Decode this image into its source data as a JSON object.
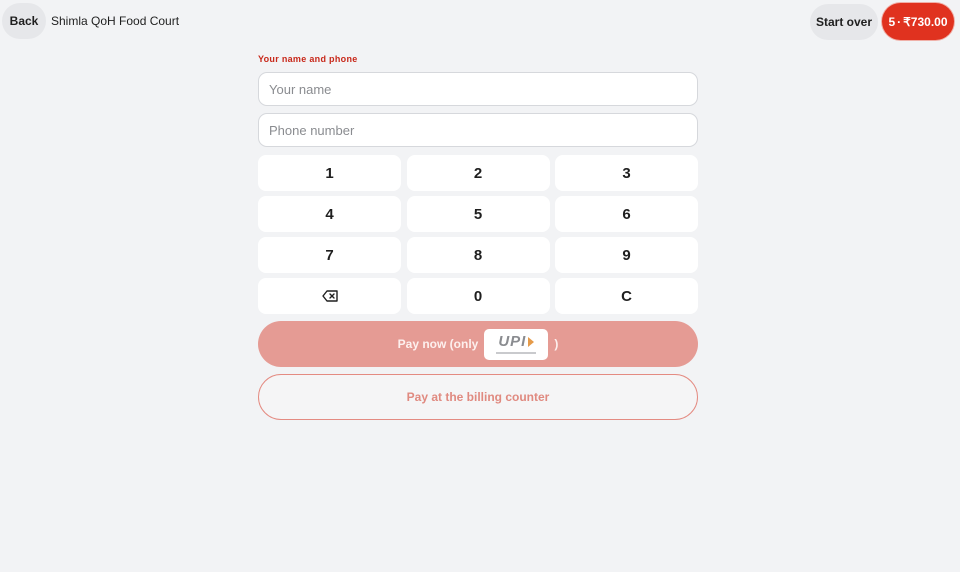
{
  "header": {
    "back_label": "Back",
    "venue_name": "Shimla QoH Food Court",
    "start_over_label": "Start over",
    "cart": {
      "count": "5",
      "separator": "·",
      "total": "₹730.00"
    }
  },
  "form": {
    "section_label": "Your name and phone",
    "name_placeholder": "Your name",
    "name_value": "",
    "phone_placeholder": "Phone number",
    "phone_value": ""
  },
  "keypad": {
    "keys": [
      "1",
      "2",
      "3",
      "4",
      "5",
      "6",
      "7",
      "8",
      "9",
      "backspace-icon",
      "0",
      "C"
    ]
  },
  "payment": {
    "pay_now_prefix": "Pay now (only",
    "pay_now_suffix": ")",
    "upi_badge_text": "UPI",
    "pay_counter_label": "Pay at the billing counter"
  },
  "colors": {
    "accent": "#e0321f",
    "pay_now_bg": "#e59b94",
    "page_bg": "#f2f3f5"
  }
}
